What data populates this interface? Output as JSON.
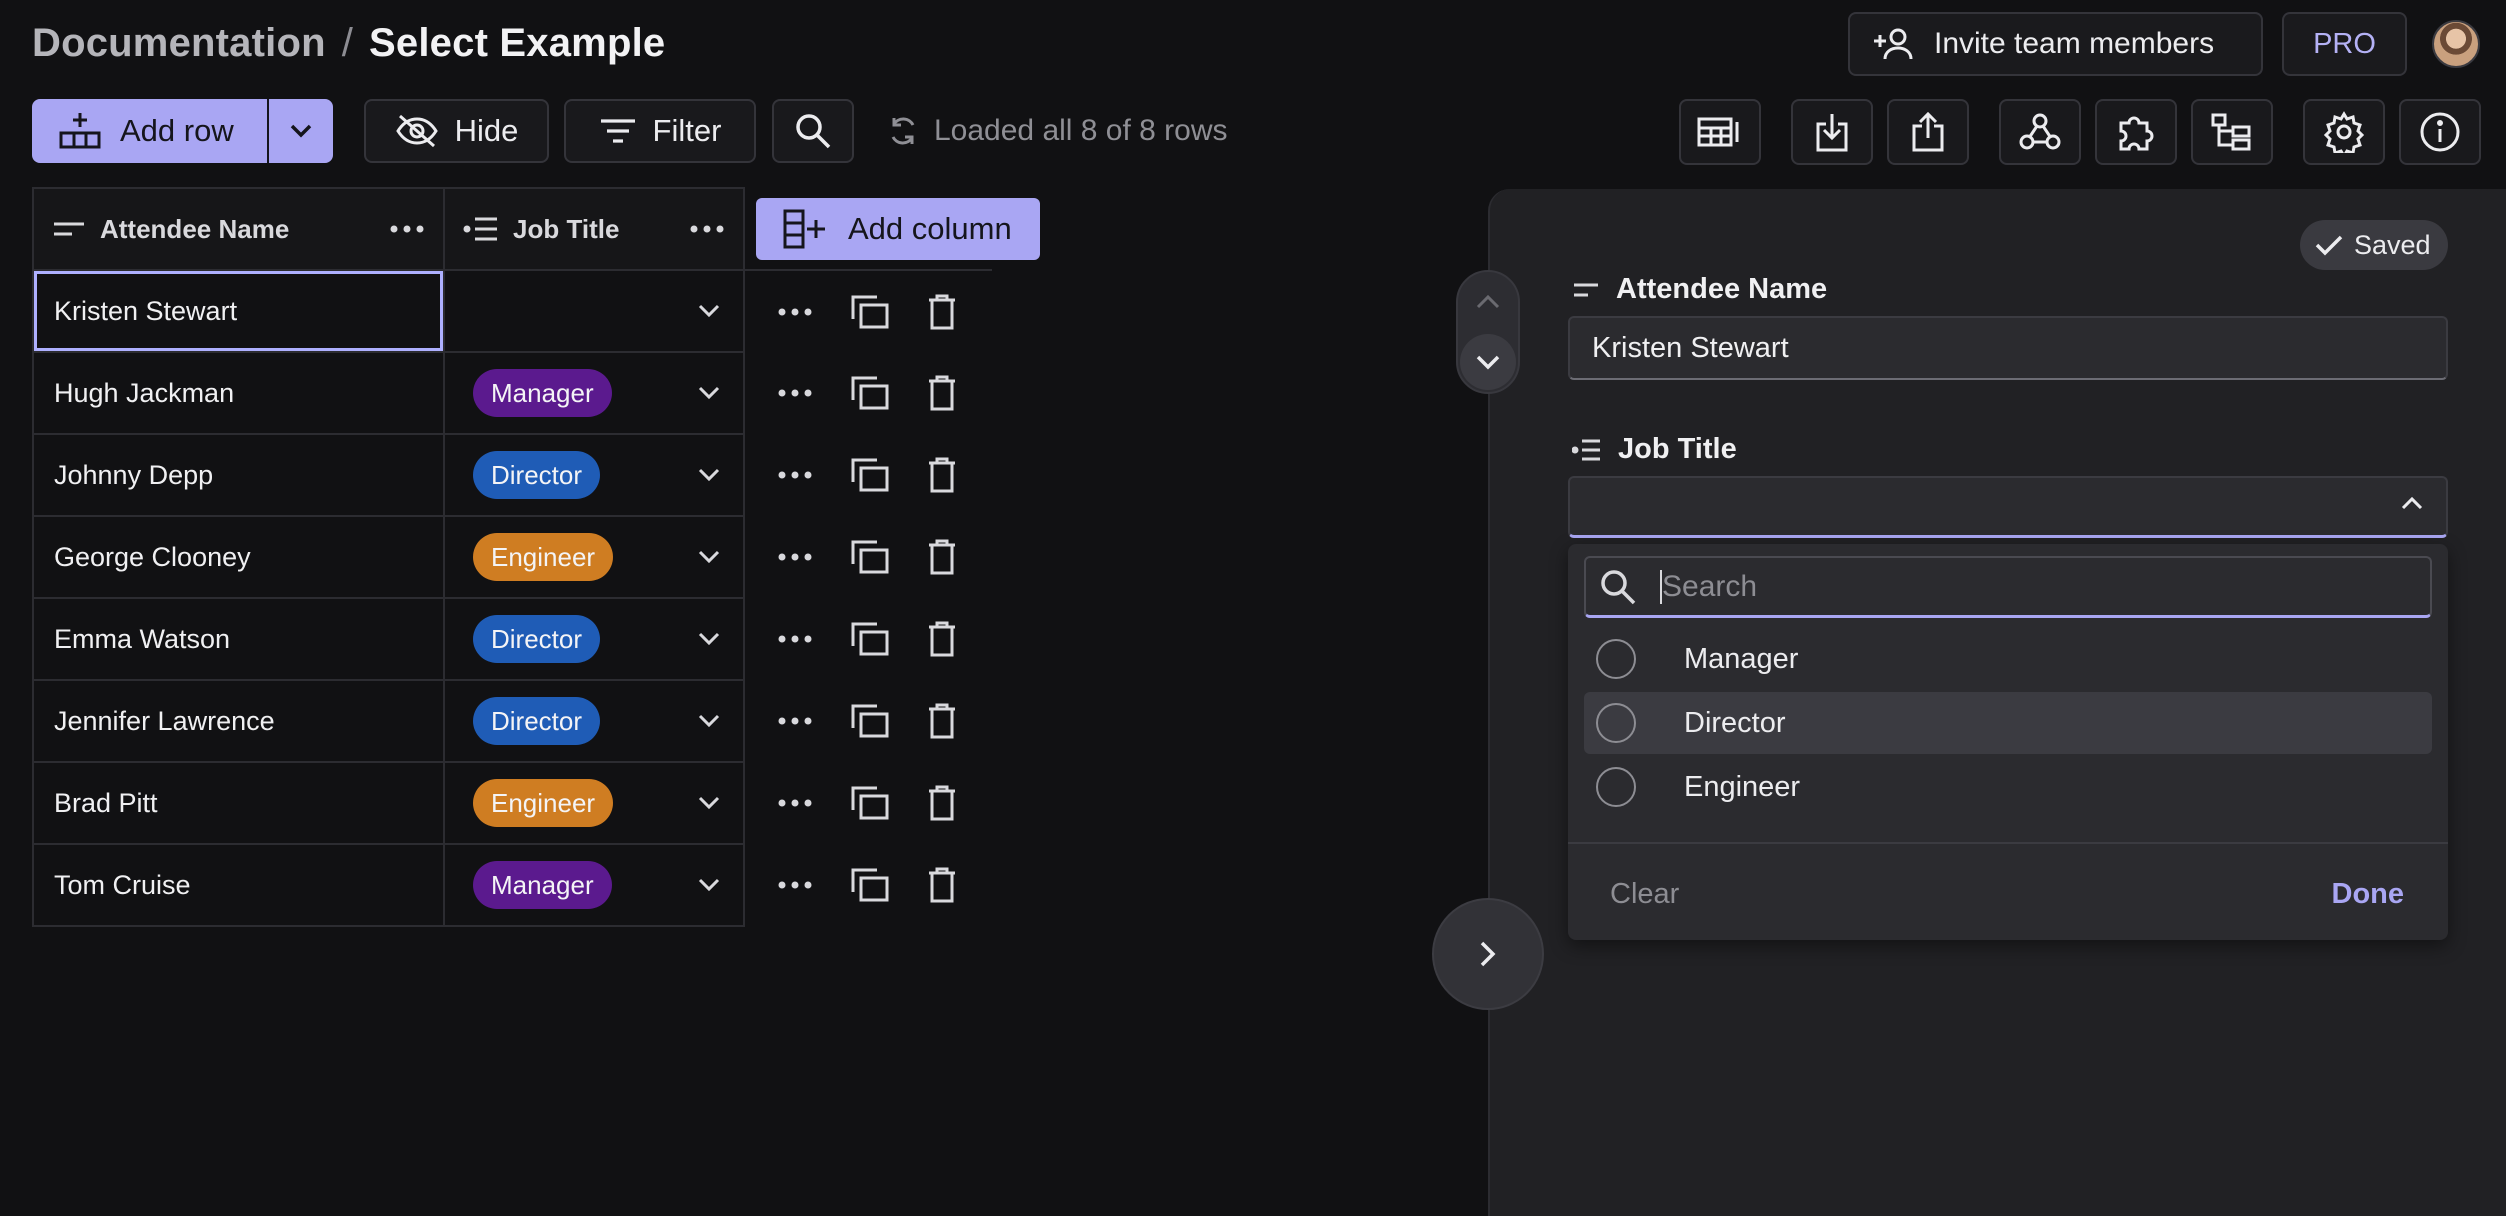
{
  "header": {
    "breadcrumb_parent": "Documentation",
    "breadcrumb_separator": "/",
    "breadcrumb_current": "Select Example",
    "invite_label": "Invite team members",
    "pro_label": "PRO"
  },
  "toolbar": {
    "add_row_label": "Add row",
    "hide_label": "Hide",
    "filter_label": "Filter",
    "status_text": "Loaded all 8 of 8 rows",
    "right_icons": [
      "table-view-icon",
      "import-icon",
      "export-icon",
      "webhook-icon",
      "extensions-icon",
      "hierarchy-icon",
      "settings-icon",
      "info-icon"
    ]
  },
  "table": {
    "columns": [
      {
        "label": "Attendee Name",
        "icon": "short-text-icon"
      },
      {
        "label": "Job Title",
        "icon": "single-select-icon"
      }
    ],
    "add_column_label": "Add column",
    "rows": [
      {
        "name": "Kristen Stewart",
        "job": ""
      },
      {
        "name": "Hugh Jackman",
        "job": "Manager"
      },
      {
        "name": "Johnny Depp",
        "job": "Director"
      },
      {
        "name": "George Clooney",
        "job": "Engineer"
      },
      {
        "name": "Emma Watson",
        "job": "Director"
      },
      {
        "name": "Jennifer Lawrence",
        "job": "Director"
      },
      {
        "name": "Brad Pitt",
        "job": "Engineer"
      },
      {
        "name": "Tom Cruise",
        "job": "Manager"
      }
    ],
    "badge_colors": {
      "Manager": "#5b1a8e",
      "Director": "#1f5cb6",
      "Engineer": "#cf7d22"
    }
  },
  "detail": {
    "saved_label": "Saved",
    "name_field_label": "Attendee Name",
    "name_value": "Kristen Stewart",
    "job_field_label": "Job Title",
    "job_value": "",
    "search_placeholder": "Search",
    "options": [
      "Manager",
      "Director",
      "Engineer"
    ],
    "clear_label": "Clear",
    "done_label": "Done"
  },
  "colors": {
    "accent": "#a9a6f3",
    "background": "#111113",
    "panel": "#212124"
  }
}
